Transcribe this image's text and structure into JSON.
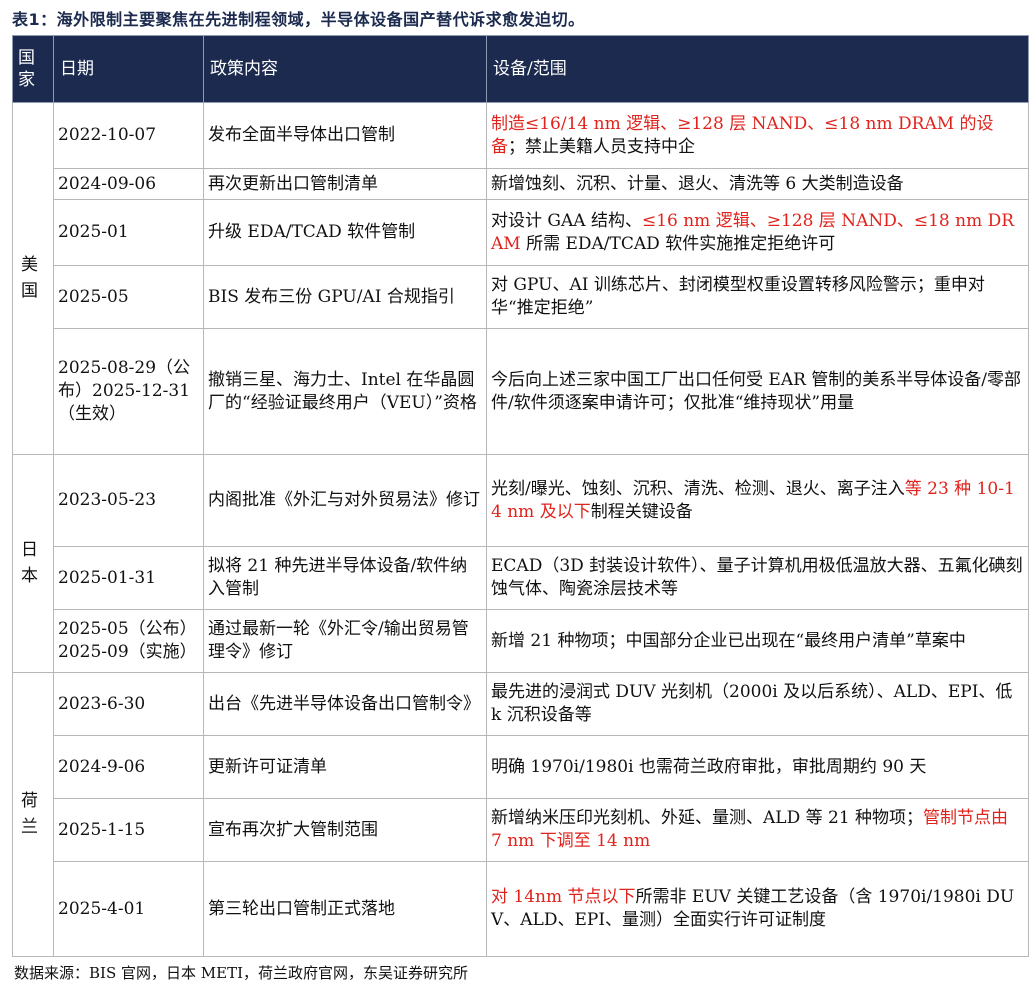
{
  "caption": "表1：海外限制主要聚焦在先进制程领域，半导体设备国产替代诉求愈发迫切。",
  "headers": {
    "country": "国家",
    "date": "日期",
    "policy": "政策内容",
    "scope": "设备/范围"
  },
  "countries": {
    "us": "美国",
    "jp": "日本",
    "nl": "荷兰"
  },
  "rows": [
    {
      "date": "2022-10-07",
      "policy": "发布全面半导体出口管制",
      "scope": [
        {
          "t": "制造≤16/14 nm 逻辑、≥128 层 NAND、≤18 nm DRAM 的设备",
          "red": true
        },
        {
          "t": "；禁止美籍人员支持中企",
          "red": false
        }
      ]
    },
    {
      "date": "2024-09-06",
      "policy": "再次更新出口管制清单",
      "scope": [
        {
          "t": "新增蚀刻、沉积、计量、退火、清洗等 6 大类制造设备",
          "red": false
        }
      ]
    },
    {
      "date": "2025-01",
      "policy": "升级 EDA/TCAD 软件管制",
      "scope": [
        {
          "t": "对设计 GAA 结构、",
          "red": false
        },
        {
          "t": "≤16 nm 逻辑、≥128 层 NAND、≤18 nm DRAM",
          "red": true
        },
        {
          "t": " 所需 EDA/TCAD 软件实施推定拒绝许可",
          "red": false
        }
      ]
    },
    {
      "date": "2025-05",
      "policy": "BIS 发布三份 GPU/AI 合规指引",
      "scope": [
        {
          "t": "对 GPU、AI 训练芯片、封闭模型权重设置转移风险警示；重申对华“推定拒绝”",
          "red": false
        }
      ]
    },
    {
      "date": "2025-08-29（公布）2025-12-31（生效）",
      "policy": "撤销三星、海力士、Intel 在华晶圆厂的“经验证最终用户（VEU）”资格",
      "scope": [
        {
          "t": "今后向上述三家中国工厂出口任何受 EAR 管制的美系半导体设备/零部件/软件须逐案申请许可；仅批准“维持现状”用量",
          "red": false
        }
      ]
    },
    {
      "date": "2023-05-23",
      "policy": "内阁批准《外汇与对外贸易法》修订",
      "scope": [
        {
          "t": "光刻/曝光、蚀刻、沉积、清洗、检测、退火、离子注入",
          "red": false
        },
        {
          "t": "等 23 种 10-14 nm 及以下",
          "red": true
        },
        {
          "t": "制程关键设备",
          "red": false
        }
      ]
    },
    {
      "date": "2025-01-31",
      "policy": "拟将 21 种先进半导体设备/软件纳入管制",
      "scope": [
        {
          "t": "ECAD（3D 封装设计软件）、量子计算机用极低温放大器、五氟化碘刻蚀气体、陶瓷涂层技术等",
          "red": false
        }
      ]
    },
    {
      "date": "2025-05（公布）2025-09（实施）",
      "policy": "通过最新一轮《外汇令/输出贸易管理令》修订",
      "scope": [
        {
          "t": "新增 21 种物项；中国部分企业已出现在“最终用户清单”草案中",
          "red": false
        }
      ]
    },
    {
      "date": "2023-6-30",
      "policy": "出台《先进半导体设备出口管制令》",
      "scope": [
        {
          "t": "最先进的浸润式 DUV 光刻机（2000i 及以后系统）、ALD、EPI、低 k 沉积设备等",
          "red": false
        }
      ]
    },
    {
      "date": "2024-9-06",
      "policy": "更新许可证清单",
      "scope": [
        {
          "t": "明确 1970i/1980i 也需荷兰政府审批，审批周期约 90 天",
          "red": false
        }
      ]
    },
    {
      "date": "2025-1-15",
      "policy": "宣布再次扩大管制范围",
      "scope": [
        {
          "t": "新增纳米压印光刻机、外延、量测、ALD 等 21 种物项；",
          "red": false
        },
        {
          "t": "管制节点由 7 nm 下调至 14 nm",
          "red": true
        }
      ]
    },
    {
      "date": "2025-4-01",
      "policy": "第三轮出口管制正式落地",
      "scope": [
        {
          "t": "对 14nm 节点以下",
          "red": true
        },
        {
          "t": "所需非 EUV 关键工艺设备（含 1970i/1980i DUV、ALD、EPI、量测）全面实行许可证制度",
          "red": false
        }
      ]
    }
  ],
  "source": "数据来源：BIS 官网，日本 METI，荷兰政府官网，东吴证券研究所"
}
